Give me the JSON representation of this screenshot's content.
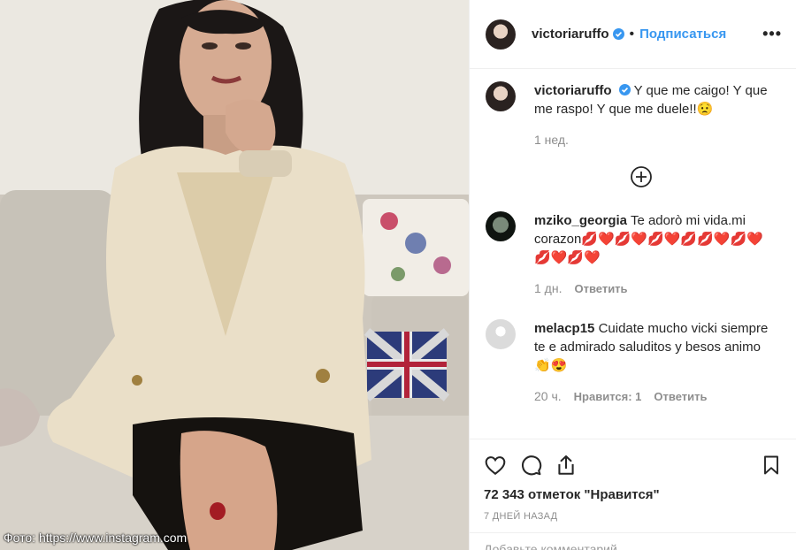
{
  "post": {
    "username": "victoriaruffo",
    "follow_label": "Подписаться",
    "more_label": "•••",
    "caption_text": "Y que me caigo! Y que me raspo! Y que me duele!!😟",
    "caption_time": "1 нед.",
    "photo_credit": "Фото: https://www.instagram.com"
  },
  "comments": [
    {
      "user": "mziko_georgia",
      "text": "Te adorò mi vida.mi corazon💋❤️💋❤️💋❤️💋💋❤️💋❤️💋❤️💋❤️",
      "time": "1 дн.",
      "likes": "",
      "reply": "Ответить"
    },
    {
      "user": "melacp15",
      "text": "Cuidate mucho vicki siempre te e admirado saluditos y besos animo👏😍",
      "time": "20 ч.",
      "likes": "Нравится: 1",
      "reply": "Ответить"
    }
  ],
  "footer": {
    "likes_text": "72 343 отметок \"Нравится\"",
    "date_text": "7 ДНЕЙ НАЗАД",
    "add_comment": "Добавьте комментарий..."
  },
  "colors": {
    "link": "#3897f0",
    "muted": "#8e8e8e",
    "text": "#262626"
  },
  "icons": [
    "heart-icon",
    "comment-icon",
    "share-icon",
    "bookmark-icon",
    "plus-circle-icon",
    "verified-icon"
  ]
}
